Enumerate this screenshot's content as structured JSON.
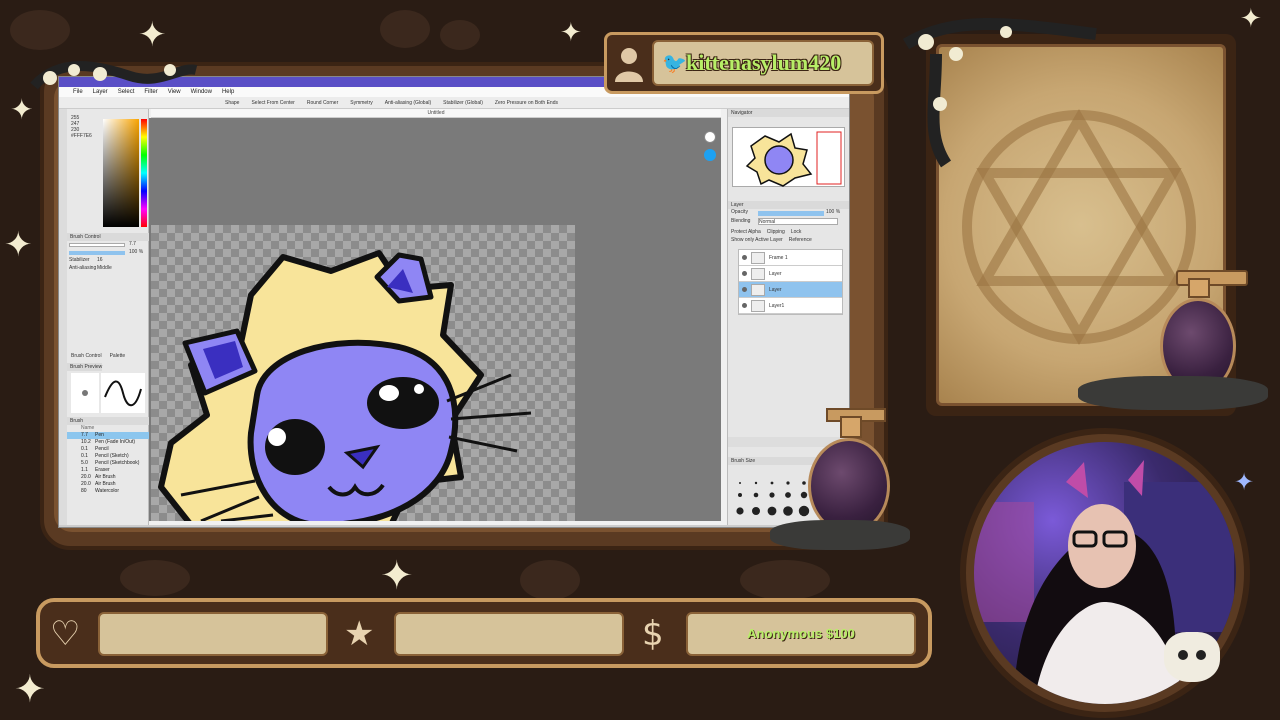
{
  "social": {
    "handle": "kittenasylum420",
    "platform_icon": "twitter-bird-icon"
  },
  "app": {
    "menu": [
      "File",
      "Layer",
      "Select",
      "Filter",
      "View",
      "Window",
      "Help"
    ],
    "toolbar": [
      "Shape",
      "Select From Center",
      "Round Corner",
      "Symmetry",
      "Anti-aliasing (Global)",
      "Stabilizer (Global)",
      "Zero Pressure on Both Ends"
    ],
    "doc_title": "Untitled",
    "color_values": [
      "255",
      "247",
      "230"
    ],
    "color_hex": "#FFF7E6",
    "brush_control": {
      "title": "Brush Control",
      "size": "7.7",
      "opacity": "100 %",
      "stabilizer_label": "Stabilizer",
      "stabilizer": "16",
      "anti_alias_label": "Anti-aliasing",
      "anti_alias": "Middle"
    },
    "tabs": [
      "Brush Control",
      "Palette"
    ],
    "brush_preview_title": "Brush Preview",
    "brush_title": "Brush",
    "brush_header": "Name",
    "brushes": [
      {
        "size": "7.7",
        "name": "Pen"
      },
      {
        "size": "10.2",
        "name": "Pen (Fade In/Out)"
      },
      {
        "size": "0.1",
        "name": "Pencil"
      },
      {
        "size": "0.1",
        "name": "Pencil (Sketch)"
      },
      {
        "size": "5.0",
        "name": "Pencil (Sketchbook)"
      },
      {
        "size": "1.1",
        "name": "Eraser"
      },
      {
        "size": "20.0",
        "name": "Air Brush"
      },
      {
        "size": "20.0",
        "name": "Air Brush"
      },
      {
        "size": "80",
        "name": "Watercolor"
      }
    ],
    "navigator_title": "Navigator",
    "layer_title": "Layer",
    "opacity_label": "Opacity",
    "opacity_value": "100 %",
    "blending_label": "Blending",
    "blending_value": "Normal",
    "layer_options": [
      "Protect Alpha",
      "Clipping",
      "Lock",
      "Show only Active Layer",
      "Reference"
    ],
    "layers": [
      {
        "name": "Frame 1",
        "selected": false
      },
      {
        "name": "Layer",
        "selected": false
      },
      {
        "name": "Layer",
        "selected": true
      },
      {
        "name": "Layer1",
        "selected": false
      }
    ],
    "brush_size_title": "Brush Size"
  },
  "bottom_bar": {
    "icons": [
      "heart-icon",
      "star-icon",
      "dollar-icon"
    ],
    "slot1": "",
    "slot2": "",
    "slot3": "Anonymous $100"
  },
  "colors": {
    "frame_brown": "#4a2e1b",
    "frame_gold": "#c89a60",
    "parchment": "#d6c39a",
    "cat_purple": "#8f86f4",
    "cat_yellow": "#f8e49a",
    "highlight_text": "#b7ee67"
  }
}
